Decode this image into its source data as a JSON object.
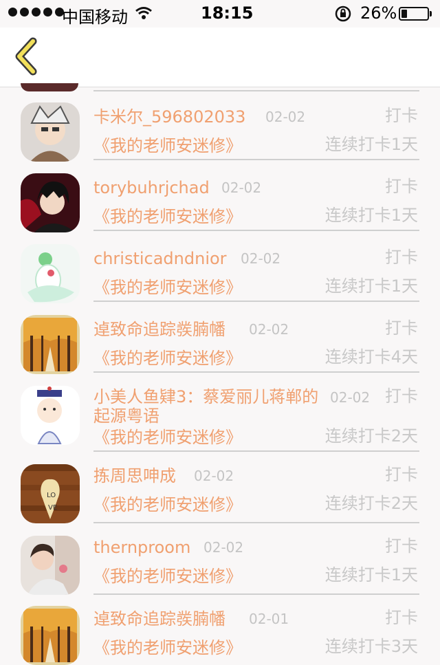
{
  "status_bar": {
    "carrier": "中国移动",
    "time": "18:15",
    "battery": "26%"
  },
  "book_title": "《我的老师安迷修》",
  "checkin_label": "打卡",
  "rows": [
    {
      "name": "卡米尔_596802033",
      "date": "02-02",
      "streak": "连续打卡1天"
    },
    {
      "name": "torybuhrjchad",
      "date": "02-02",
      "streak": "连续打卡1天"
    },
    {
      "name": "christicadndnior",
      "date": "02-02",
      "streak": "连续打卡1天"
    },
    {
      "name": "逴致命追踪彂腩幡",
      "date": "02-02",
      "streak": "连续打卡4天"
    },
    {
      "name": "小美人鱼肄3：蔡爱丽儿蒋郸的起源粤语",
      "date": "02-02",
      "streak": "连续打卡2天"
    },
    {
      "name": "拣周思呻成",
      "date": "02-02",
      "streak": "连续打卡2天"
    },
    {
      "name": "thernproom",
      "date": "02-02",
      "streak": "连续打卡1天"
    },
    {
      "name": "逴致命追踪彂腩幡",
      "date": "02-01",
      "streak": "连续打卡3天"
    }
  ]
}
